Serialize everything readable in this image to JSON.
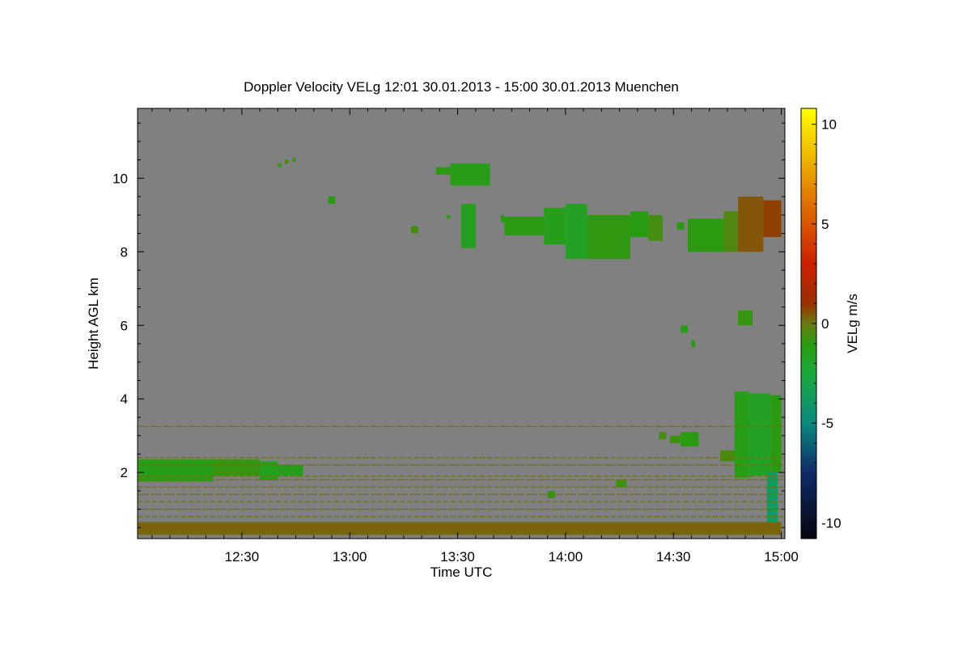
{
  "chart_data": {
    "type": "heatmap",
    "title": "Doppler Velocity VELg   12:01 30.01.2013 - 15:00 30.01.2013 Muenchen",
    "xlabel": "Time UTC",
    "ylabel": "Height AGL km",
    "colorbar_label": "VELg m/s",
    "x_range_minutes_utc": [
      721,
      901
    ],
    "x_ticks": [
      {
        "label": "12:30",
        "value": 750
      },
      {
        "label": "13:00",
        "value": 780
      },
      {
        "label": "13:30",
        "value": 810
      },
      {
        "label": "14:00",
        "value": 840
      },
      {
        "label": "14:30",
        "value": 870
      },
      {
        "label": "15:00",
        "value": 900
      }
    ],
    "ylim_km": [
      0.2,
      11.9
    ],
    "y_ticks": [
      {
        "label": "2",
        "value": 2
      },
      {
        "label": "4",
        "value": 4
      },
      {
        "label": "6",
        "value": 6
      },
      {
        "label": "8",
        "value": 8
      },
      {
        "label": "10",
        "value": 10
      }
    ],
    "colorbar": {
      "vmin": -10.8,
      "vmax": 10.8,
      "ticks": [
        {
          "label": "10",
          "value": 10
        },
        {
          "label": "5",
          "value": 5
        },
        {
          "label": "0",
          "value": 0
        },
        {
          "label": "-5",
          "value": -5
        },
        {
          "label": "-10",
          "value": -10
        }
      ],
      "colormap": [
        {
          "v": -10.8,
          "color": "#05050f"
        },
        {
          "v": -7.5,
          "color": "#0f2a6a"
        },
        {
          "v": -5,
          "color": "#0a8a80"
        },
        {
          "v": -2.5,
          "color": "#1aaa3a"
        },
        {
          "v": -1,
          "color": "#2a9a10"
        },
        {
          "v": 0,
          "color": "#6a7a10"
        },
        {
          "v": 1,
          "color": "#9a3000"
        },
        {
          "v": 3,
          "color": "#cc2000"
        },
        {
          "v": 6,
          "color": "#e07000"
        },
        {
          "v": 10.8,
          "color": "#ffff00"
        }
      ]
    },
    "background_color": "#808080",
    "echo_regions": [
      {
        "t0": 721,
        "t1": 742,
        "h0": 1.75,
        "h1": 2.35,
        "vel": -1.3
      },
      {
        "t0": 742,
        "t1": 755,
        "h0": 1.9,
        "h1": 2.35,
        "vel": -0.8
      },
      {
        "t0": 755,
        "t1": 760,
        "h0": 1.8,
        "h1": 2.3,
        "vel": -1.5
      },
      {
        "t0": 760,
        "t1": 767,
        "h0": 1.9,
        "h1": 2.2,
        "vel": -1.4
      },
      {
        "t0": 760,
        "t1": 761,
        "h0": 10.3,
        "h1": 10.4,
        "vel": -0.8
      },
      {
        "t0": 762,
        "t1": 763,
        "h0": 10.4,
        "h1": 10.5,
        "vel": -0.6
      },
      {
        "t0": 764,
        "t1": 765,
        "h0": 10.45,
        "h1": 10.55,
        "vel": -0.7
      },
      {
        "t0": 774,
        "t1": 776,
        "h0": 9.3,
        "h1": 9.5,
        "vel": -1.0
      },
      {
        "t0": 797,
        "t1": 799,
        "h0": 8.5,
        "h1": 8.7,
        "vel": -0.6
      },
      {
        "t0": 804,
        "t1": 808,
        "h0": 10.1,
        "h1": 10.3,
        "vel": -1.0
      },
      {
        "t0": 808,
        "t1": 819,
        "h0": 9.8,
        "h1": 10.4,
        "vel": -1.3
      },
      {
        "t0": 807,
        "t1": 808,
        "h0": 8.9,
        "h1": 9.0,
        "vel": -1.1
      },
      {
        "t0": 811,
        "t1": 815,
        "h0": 8.1,
        "h1": 9.3,
        "vel": -1.5
      },
      {
        "t0": 822,
        "t1": 823,
        "h0": 8.8,
        "h1": 9.0,
        "vel": -1.0
      },
      {
        "t0": 823,
        "t1": 834,
        "h0": 8.45,
        "h1": 8.95,
        "vel": -1.0
      },
      {
        "t0": 834,
        "t1": 840,
        "h0": 8.2,
        "h1": 9.2,
        "vel": -1.4
      },
      {
        "t0": 840,
        "t1": 846,
        "h0": 7.8,
        "h1": 9.3,
        "vel": -1.7
      },
      {
        "t0": 846,
        "t1": 858,
        "h0": 7.8,
        "h1": 9.0,
        "vel": -0.9
      },
      {
        "t0": 858,
        "t1": 863,
        "h0": 8.4,
        "h1": 9.1,
        "vel": -1.1
      },
      {
        "t0": 863,
        "t1": 867,
        "h0": 8.3,
        "h1": 9.0,
        "vel": -0.6
      },
      {
        "t0": 871,
        "t1": 873,
        "h0": 8.6,
        "h1": 8.8,
        "vel": -1.0
      },
      {
        "t0": 874,
        "t1": 884,
        "h0": 8.0,
        "h1": 8.9,
        "vel": -1.0
      },
      {
        "t0": 884,
        "t1": 888,
        "h0": 8.0,
        "h1": 9.1,
        "vel": -0.4
      },
      {
        "t0": 888,
        "t1": 895,
        "h0": 8.0,
        "h1": 9.5,
        "vel": 0.5
      },
      {
        "t0": 895,
        "t1": 900,
        "h0": 8.4,
        "h1": 9.4,
        "vel": 0.8
      },
      {
        "t0": 888,
        "t1": 892,
        "h0": 6.0,
        "h1": 6.4,
        "vel": -0.8
      },
      {
        "t0": 872,
        "t1": 874,
        "h0": 5.8,
        "h1": 6.0,
        "vel": -1.2
      },
      {
        "t0": 875,
        "t1": 876,
        "h0": 5.4,
        "h1": 5.6,
        "vel": -1.0
      },
      {
        "t0": 866,
        "t1": 868,
        "h0": 2.9,
        "h1": 3.1,
        "vel": -0.6
      },
      {
        "t0": 869,
        "t1": 872,
        "h0": 2.8,
        "h1": 3.0,
        "vel": -0.7
      },
      {
        "t0": 872,
        "t1": 877,
        "h0": 2.7,
        "h1": 3.1,
        "vel": -1.0
      },
      {
        "t0": 883,
        "t1": 888,
        "h0": 2.3,
        "h1": 2.6,
        "vel": -0.5
      },
      {
        "t0": 887,
        "t1": 891,
        "h0": 1.85,
        "h1": 4.2,
        "vel": -1.3
      },
      {
        "t0": 891,
        "t1": 897,
        "h0": 1.9,
        "h1": 4.15,
        "vel": -1.7
      },
      {
        "t0": 897,
        "t1": 900,
        "h0": 2.0,
        "h1": 4.1,
        "vel": -1.0
      },
      {
        "t0": 896,
        "t1": 899,
        "h0": 0.4,
        "h1": 2.0,
        "vel": -3.8
      },
      {
        "t0": 854,
        "t1": 857,
        "h0": 1.6,
        "h1": 1.8,
        "vel": -0.7
      },
      {
        "t0": 835,
        "t1": 837,
        "h0": 1.3,
        "h1": 1.5,
        "vel": -0.9
      },
      {
        "t0": 721,
        "t1": 900,
        "h0": 0.3,
        "h1": 0.65,
        "vel": 0.3
      }
    ],
    "clutter_layers_km": [
      3.25,
      2.4,
      2.2,
      1.9,
      1.8,
      1.6,
      1.4,
      1.2,
      1.0,
      0.8
    ]
  }
}
